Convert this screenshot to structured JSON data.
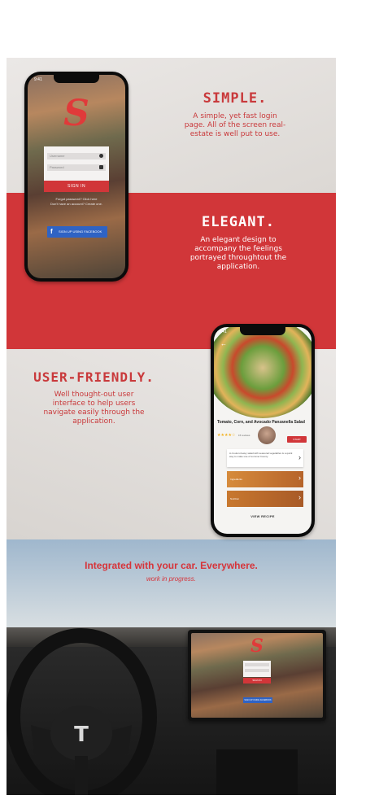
{
  "sections": {
    "simple": {
      "title": "SIMPLE.",
      "body": "A simple, yet fast login page. All of the screen real-estate is well put to use."
    },
    "elegant": {
      "title": "ELEGANT.",
      "body": "An elegant design to accompany the feelings portrayed throughtout the application."
    },
    "user_friendly": {
      "title": "USER-FRIENDLY.",
      "body": "Well thought-out user interface to help users navigate easily through the application."
    },
    "car": {
      "title": "Integrated with your car. Everywhere.",
      "subtitle": "work in progress."
    }
  },
  "login_phone": {
    "time": "9:41",
    "logo": "S",
    "username_placeholder": "Username",
    "password_placeholder": "Password",
    "sign_in": "SIGN IN",
    "forgot": "Forgot password? Click here",
    "no_account": "Don't have an account? Create one.",
    "facebook": "SIGN UP USING FACEBOOK"
  },
  "recipe_phone": {
    "time": "9:41",
    "title": "Tomato, Corn, and Avocado Panzanella Salad",
    "reviews": "15 reviews",
    "start_button": "START",
    "description": "A crouton-heavy salad with seasonal vegetables is a quick way to make use of summer bounty.",
    "section_1": "Ingredients",
    "section_2": "Nutrition",
    "view_recipe": "VIEW RECIPE"
  },
  "car_screen": {
    "logo": "S",
    "sign_in": "SIGN IN",
    "facebook": "SIGN UP USING FACEBOOK"
  },
  "colors": {
    "brand_red": "#d13639",
    "heading_red": "#c9393b",
    "facebook_blue": "#2f63c4"
  }
}
